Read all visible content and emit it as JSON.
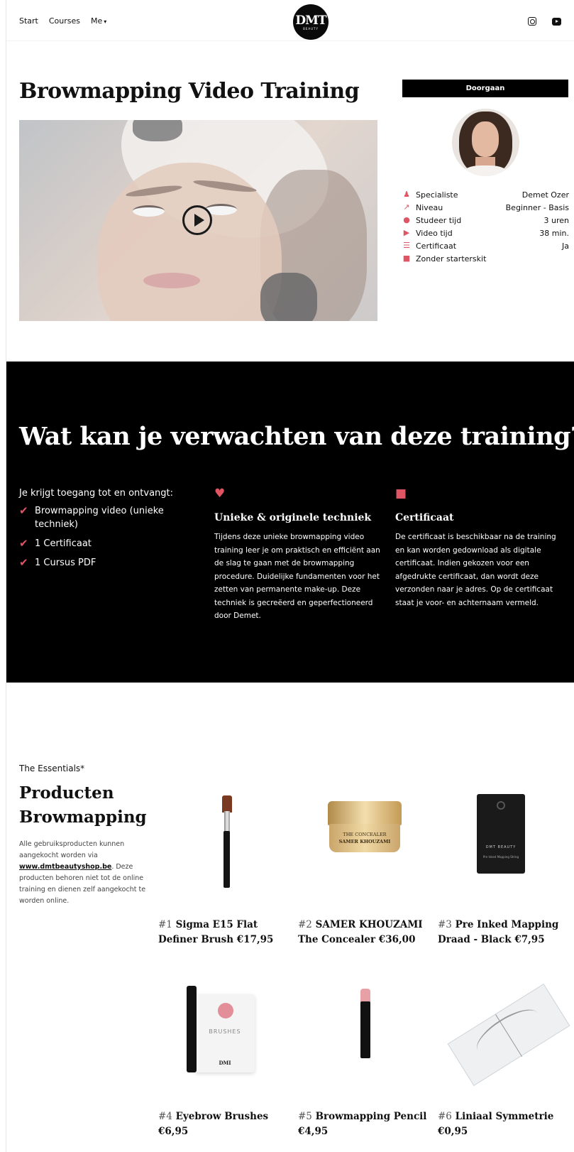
{
  "header": {
    "nav": [
      "Start",
      "Courses",
      "Me"
    ],
    "nav_chevron": "chevron-down-icon",
    "logo_text": "DMT",
    "logo_sub": "BEAUTY",
    "social": [
      "instagram-icon",
      "youtube-icon"
    ]
  },
  "hero": {
    "title": "Browmapping Video Training",
    "video_control": "play-icon"
  },
  "sidebar": {
    "continue_label": "Doorgaan",
    "specs": [
      {
        "icon": "user-icon",
        "label": "Specialiste",
        "value": "Demet Ozer"
      },
      {
        "icon": "chart-icon",
        "label": "Niveau",
        "value": "Beginner - Basis"
      },
      {
        "icon": "clock-icon",
        "label": "Studeer tijd",
        "value": "3 uren"
      },
      {
        "icon": "play-circle-icon",
        "label": "Video tijd",
        "value": "38 min."
      },
      {
        "icon": "list-icon",
        "label": "Certificaat",
        "value": "Ja"
      },
      {
        "icon": "box-icon",
        "label": "Zonder starterskit",
        "value": ""
      }
    ]
  },
  "expect": {
    "title": "Wat kan je verwachten van deze training?",
    "includes_head": "Je krijgt toegang tot en ontvangt:",
    "includes": [
      "Browmapping video (unieke techniek)",
      "1 Certificaat",
      "1 Cursus PDF"
    ],
    "features": [
      {
        "icon": "hand-heart-icon",
        "title": "Unieke & originele techniek",
        "text": "Tijdens deze unieke browmapping video training leer je om praktisch en efficiënt aan de slag te gaan met de browmapping procedure. Duidelijke fundamenten voor het zetten van permanente make-up. Deze techniek is gecreëerd en geperfectioneerd door Demet."
      },
      {
        "icon": "gift-icon",
        "title": "Certificaat",
        "text": "De certificaat is beschikbaar na de training en kan worden gedownload als digitale certificaat. Indien gekozen voor een afgedrukte certificaat, dan wordt deze verzonden naar je adres. Op de certificaat staat je voor- en achternaam vermeld."
      }
    ]
  },
  "essentials": {
    "kicker": "The Essentials*",
    "title_1": "Producten",
    "title_2": "Browmapping",
    "desc_1": "Alle gebruiksproducten kunnen aangekocht worden via",
    "desc_link": "www.dmtbeautyshop.be",
    "desc_2": ". Deze producten behoren niet tot de online training en dienen zelf aangekocht te worden online.",
    "products": [
      {
        "hash": "#1",
        "name": "Sigma E15 Flat Definer Brush €17,95"
      },
      {
        "hash": "#2",
        "name": "SAMER KHOUZAMI The Concealer €36,00",
        "label_1": "THE CONCEALER",
        "label_2": "SAMER KHOUZAMI"
      },
      {
        "hash": "#3",
        "name": "Pre Inked Mapping Draad - Black €7,95",
        "label_1": "DMT BEAUTY",
        "label_2": "Pre Inked Mapping String"
      },
      {
        "hash": "#4",
        "name": "Eyebrow Brushes €6,95",
        "label_1": "BRUSHES",
        "label_2": "DMI"
      },
      {
        "hash": "#5",
        "name": "Browmapping Pencil €4,95"
      },
      {
        "hash": "#6",
        "name": "Liniaal Symmetrie €0,95"
      }
    ]
  },
  "colors": {
    "accent": "#e05564",
    "black": "#000000"
  }
}
